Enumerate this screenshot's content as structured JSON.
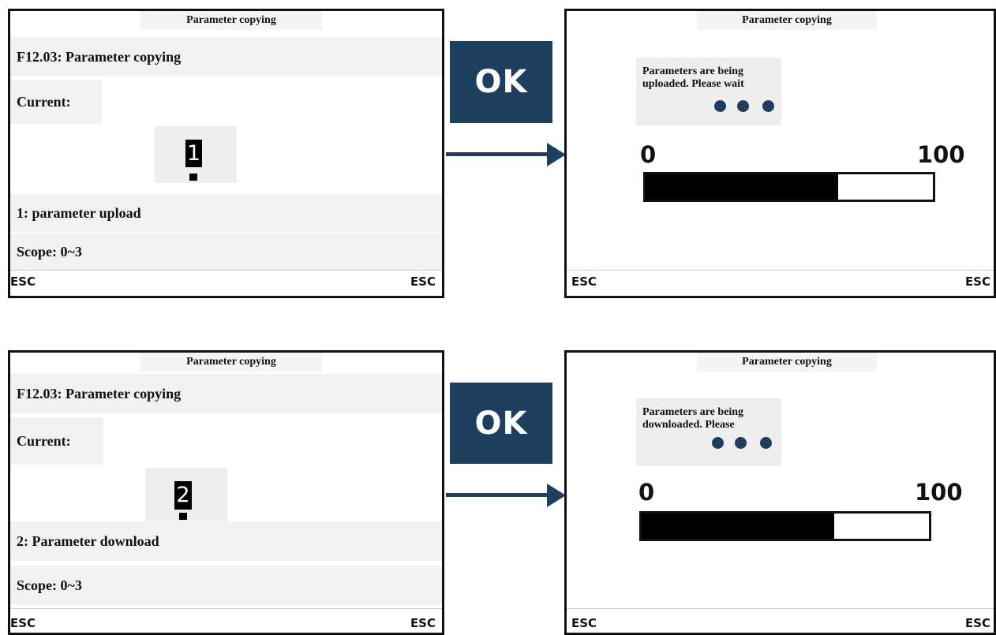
{
  "screens": {
    "top_left": {
      "title": "Parameter copying",
      "param_line": "F12.03: Parameter copying",
      "current_label": "Current:",
      "value": "1",
      "description": "1: parameter upload",
      "scope": "Scope: 0~3",
      "esc_left": "ESC",
      "esc_right": "ESC"
    },
    "top_right": {
      "title": "Parameter copying",
      "message_line1": "Parameters are being",
      "message_line2": "uploaded. Please wait",
      "scale_min": "0",
      "scale_max": "100",
      "progress": 0.67,
      "esc_left": "ESC",
      "esc_right": "ESC"
    },
    "bottom_left": {
      "title": "Parameter copying",
      "param_line": "F12.03: Parameter copying",
      "current_label": "Current:",
      "value": "2",
      "description": "2: Parameter download",
      "scope": "Scope: 0~3",
      "esc_left": "ESC",
      "esc_right": "ESC"
    },
    "bottom_right": {
      "title": "Parameter copying",
      "message_line1": "Parameters are being",
      "message_line2": "downloaded. Please",
      "scale_min": "0",
      "scale_max": "100",
      "progress": 0.67,
      "esc_left": "ESC",
      "esc_right": "ESC"
    }
  },
  "ok_buttons": {
    "top": "OK",
    "bottom": "OK"
  },
  "icons": [
    "arrow-right-icon",
    "loading-dots-icon",
    "cursor-icon"
  ],
  "colors": {
    "ok_button": "#1f3f5e",
    "arrow": "#1f3f5e",
    "dots": "#203e5b",
    "progress_fill": "#000000"
  }
}
